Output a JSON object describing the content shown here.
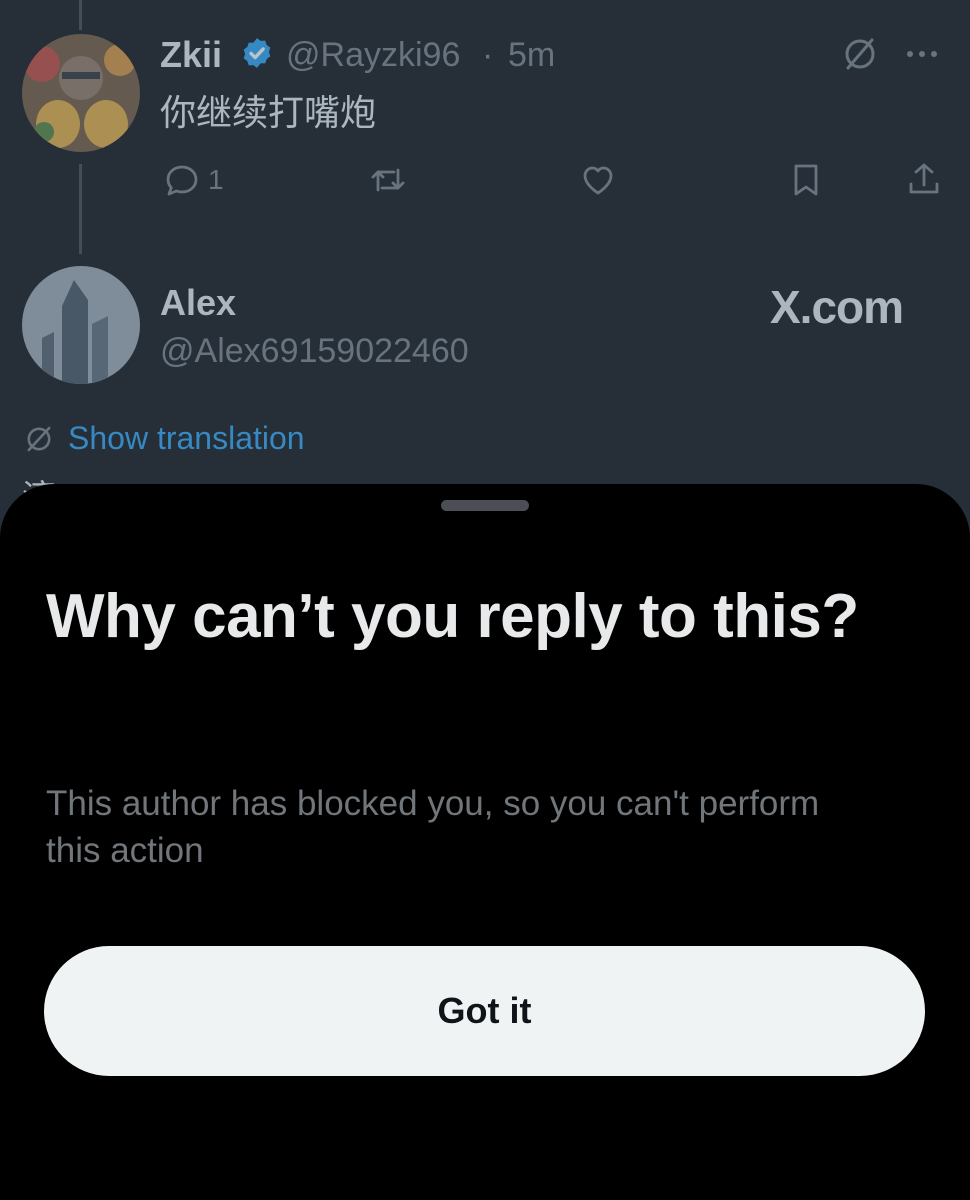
{
  "tweet": {
    "author_name": "Zkii",
    "author_handle": "@Rayzki96",
    "separator": "·",
    "time": "5m",
    "text": "你继续打嘴炮",
    "reply_count": "1"
  },
  "reply": {
    "author_name": "Alex",
    "author_handle": "@Alex69159022460",
    "watermark": "X.com",
    "show_translation": "Show translation",
    "partial_text": "滚"
  },
  "sheet": {
    "title": "Why can’t you reply to this?",
    "body": "This author has blocked you, so you can't perform this action",
    "button_label": "Got it"
  },
  "colors": {
    "accent": "#1d9bf0",
    "text_primary": "#e7e9ea",
    "text_secondary": "#71767b",
    "button_bg": "#eff3f4",
    "button_text": "#0f1419"
  },
  "icons": [
    "verified-badge-icon",
    "grok-slash-icon",
    "more-icon",
    "reply-icon",
    "retweet-icon",
    "like-icon",
    "bookmark-icon",
    "share-icon",
    "translate-icon"
  ]
}
